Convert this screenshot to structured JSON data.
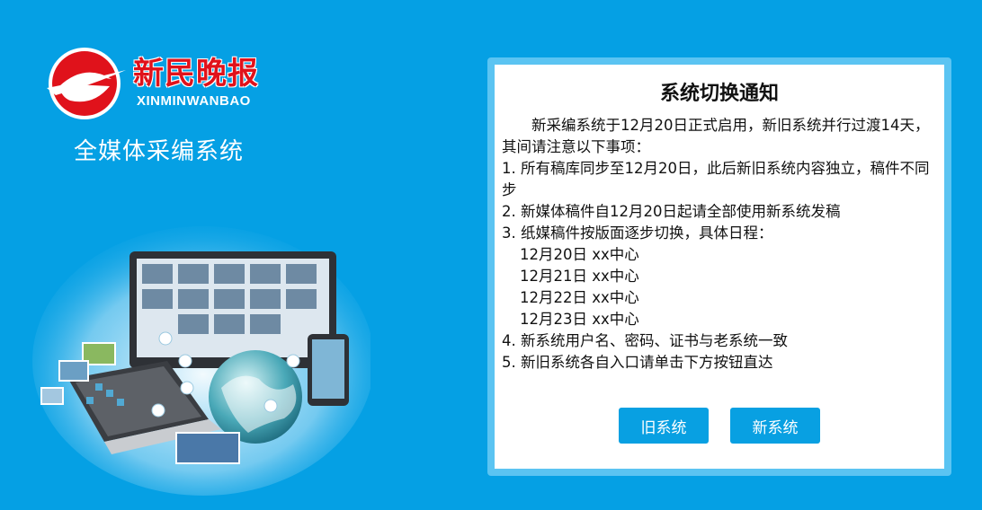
{
  "brand": {
    "name_cn": "新民晚报",
    "name_en": "XINMINWANBAO",
    "logo_color": "#e0121b",
    "system_name": "全媒体采编系统"
  },
  "notice": {
    "title": "系统切换通知",
    "intro": "新采编系统于12月20日正式启用，新旧系统并行过渡14天，其间请注意以下事项：",
    "items": [
      "1. 所有稿库同步至12月20日，此后新旧系统内容独立，稿件不同步",
      "2. 新媒体稿件自12月20日起请全部使用新系统发稿",
      "3. 纸媒稿件按版面逐步切换，具体日程："
    ],
    "schedule": [
      "12月20日 xx中心",
      "12月21日 xx中心",
      "12月22日 xx中心",
      "12月23日 xx中心"
    ],
    "items_after": [
      "4. 新系统用户名、密码、证书与老系统一致",
      "5. 新旧系统各自入口请单击下方按钮直达"
    ]
  },
  "buttons": {
    "old_system": "旧系统",
    "new_system": "新系统"
  },
  "colors": {
    "background": "#05a0e4",
    "panel_border": "#5bc4f2",
    "button": "#08a0e2"
  },
  "illustration": {
    "icon": "media-devices-illustration"
  }
}
